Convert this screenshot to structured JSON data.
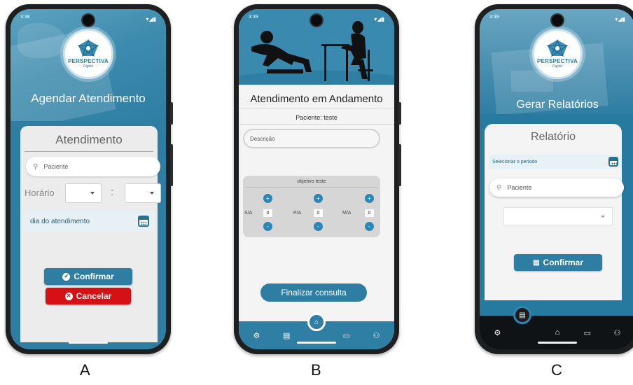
{
  "status": {
    "a_time": "3:38",
    "b_time": "3:39",
    "c_time": "3:39",
    "icons": "▾◢▮"
  },
  "logo": {
    "name": "PERSPECTIVA",
    "sub": "Digital"
  },
  "screen_a": {
    "title": "Agendar Atendimento",
    "card_title": "Atendimento",
    "patient_placeholder": "Paciente",
    "time_label": "Horário",
    "time_separator": ":",
    "date_label": "dia do atendimento",
    "confirm": "Confirmar",
    "cancel": "Cancelar"
  },
  "screen_b": {
    "title": "Atendimento em Andamento",
    "patient": "Paciente: teste",
    "description_placeholder": "Descrição",
    "objective": "objetivo teste",
    "counters": [
      {
        "label": "S/A",
        "value": "0"
      },
      {
        "label": "P/A",
        "value": "0"
      },
      {
        "label": "M/A",
        "value": "0"
      }
    ],
    "finish": "Finalizar consulta"
  },
  "screen_c": {
    "title": "Gerar Relatórios",
    "card_title": "Relatório",
    "period_label": "Selecionar o periodo",
    "patient_placeholder": "Paciente",
    "confirm": "Confirmar"
  },
  "captions": {
    "a": "A",
    "b": "B",
    "c": "C"
  },
  "colors": {
    "primary": "#2e7ea3",
    "danger": "#d51116",
    "card": "#ececec"
  },
  "icons": [
    "search-icon",
    "calendar-icon",
    "check-circle-icon",
    "close-circle-icon",
    "gear-icon",
    "document-icon",
    "home-icon",
    "calendar-nav-icon",
    "users-icon"
  ]
}
